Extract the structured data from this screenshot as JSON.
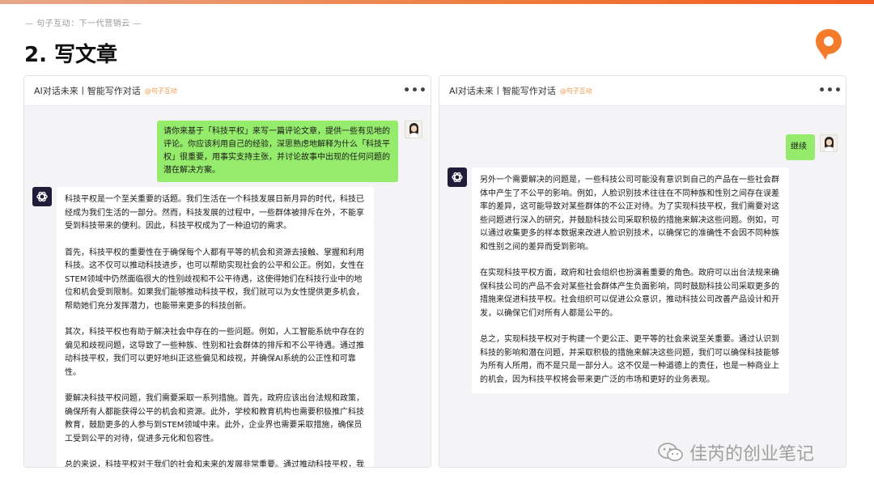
{
  "header": {
    "note": "— 句子互动：下一代营销云 —",
    "title": "2. 写文章"
  },
  "brand": {
    "accent": "#f25c1f",
    "logo_icon": "orange-chat-location-icon"
  },
  "left_panel": {
    "title": "AI对话未来丨智能写作对话",
    "tag": "@句子互动",
    "more": "•••",
    "user_message": "请你来基于「科技平权」来写一篇评论文章，提供一些有见地的评论。你应该利用自己的经验，深思熟虑地解释为什么「科技平权」很重要，用事实支持主张，并讨论故事中出现的任何问题的潜在解决方案。",
    "ai_paragraphs": [
      "科技平权是一个至关重要的话题。我们生活在一个科技发展日新月异的时代，科技已经成为我们生活的一部分。然而，科技发展的过程中，一些群体被排斥在外，不能享受到科技带来的便利。因此，科技平权成为了一种迫切的需求。",
      "首先，科技平权的重要性在于确保每个人都有平等的机会和资源去接触、掌握和利用科技。这不仅可以推动科技进步，也可以帮助实现社会的公平和公正。例如，女性在STEM领域中仍然面临很大的性别歧视和不公平待遇，这使得她们在科技行业中的地位和机会受到限制。如果我们能够推动科技平权，我们就可以为女性提供更多机会，帮助她们充分发挥潜力，也能带来更多的科技创新。",
      "其次，科技平权也有助于解决社会中存在的一些问题。例如，人工智能系统中存在的偏见和歧视问题，这导致了一些种族、性别和社会群体的排斥和不公平待遇。通过推动科技平权，我们可以更好地纠正这些偏见和歧视，并确保AI系统的公正性和可靠性。",
      "要解决科技平权问题，我们需要采取一系列措施。首先，政府应该出台法规和政策，确保所有人都能获得公平的机会和资源。此外，学校和教育机构也需要积极推广科技教育，鼓励更多的人参与到STEM领域中来。此外，企业界也需要采取措施，确保员工受到公平的对待，促进多元化和包容性。",
      "总的来说，科技平权对于我们的社会和未来的发展非常重要。通过推动科技平权，我们可以实现公平、公正和可持续的社会发展，为所有人创造更美好的未来。"
    ]
  },
  "right_panel": {
    "title": "AI对话未来丨智能写作对话",
    "tag": "@句子互动",
    "more": "•••",
    "user_message": "继续",
    "ai_paragraphs": [
      "另外一个需要解决的问题是，一些科技公司可能没有意识到自己的产品在一些社会群体中产生了不公平的影响。例如，人脸识别技术往往在不同种族和性别之间存在误差率的差异，这可能导致对某些群体的不公正对待。为了实现科技平权，我们需要对这些问题进行深入的研究，并鼓励科技公司采取积极的措施来解决这些问题。例如，可以通过收集更多的样本数据来改进人脸识别技术，以确保它的准确性不会因不同种族和性别之间的差异而受到影响。",
      "在实现科技平权方面，政府和社会组织也扮演着重要的角色。政府可以出台法规来确保科技公司的产品不会对某些社会群体产生负面影响，同时鼓励科技公司采取更多的措施来促进科技平权。社会组织可以促进公众意识，推动科技公司改善产品设计和开发，以确保它们对所有人都是公平的。",
      "总之，实现科技平权对于构建一个更公正、更平等的社会来说至关重要。通过认识到科技的影响和潜在问题，并采取积极的措施来解决这些问题，我们可以确保科技能够为所有人所用，而不是只是一部分人。这不仅是一种道德上的责任，也是一种商业上的机会，因为科技平权将会带来更广泛的市场和更好的业务表现。"
    ]
  },
  "watermark": {
    "text": "佳芮的创业笔记",
    "icon": "wechat-icon"
  }
}
